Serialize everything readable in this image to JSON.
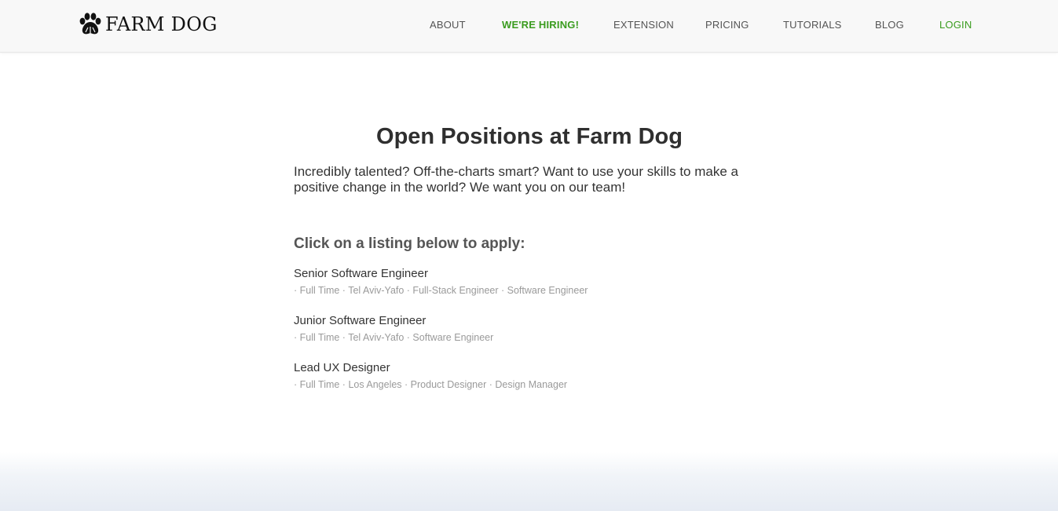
{
  "brand": {
    "name": "FARM DOG",
    "logo_icon": "paw-icon"
  },
  "nav": {
    "items": [
      {
        "label": "ABOUT"
      },
      {
        "label": "WE'RE HIRING!"
      },
      {
        "label": "EXTENSION"
      },
      {
        "label": "PRICING"
      },
      {
        "label": "TUTORIALS"
      },
      {
        "label": "BLOG"
      },
      {
        "label": "LOGIN"
      }
    ]
  },
  "colors": {
    "accent": "#3a9c1f",
    "nav_text": "#555555",
    "header_bg": "#f8f8f8"
  },
  "main": {
    "title": "Open Positions at Farm Dog",
    "intro": "Incredibly talented? Off-the-charts smart? Want to use your skills to make a positive change in the world? We want you on our team!",
    "apply_heading": "Click on a listing below to apply:",
    "listings": [
      {
        "title": "Senior Software Engineer",
        "meta": "· Full Time · Tel Aviv-Yafo · Full-Stack Engineer · Software Engineer"
      },
      {
        "title": "Junior Software Engineer",
        "meta": "· Full Time · Tel Aviv-Yafo · Software Engineer"
      },
      {
        "title": "Lead UX Designer",
        "meta": "· Full Time · Los Angeles · Product Designer · Design Manager"
      }
    ]
  }
}
